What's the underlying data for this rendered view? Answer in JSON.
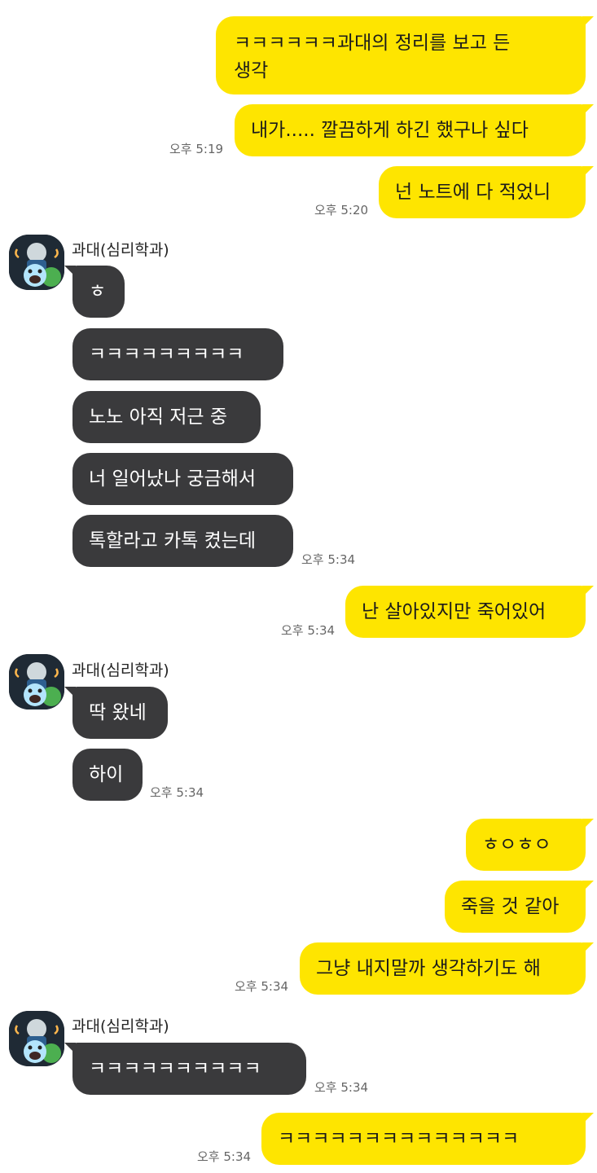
{
  "partner": {
    "name": "과대(심리학과)"
  },
  "colors": {
    "my_bubble": "#fee500",
    "their_bubble": "#3a3a3c",
    "background": "#ffffff"
  },
  "messages": [
    {
      "from": "me",
      "text": "ㅋㅋㅋㅋㅋㅋ과대의 정리를 보고 든\n생각"
    },
    {
      "from": "me",
      "text": "내가..... 깔끔하게 하긴 했구나 싶다",
      "time": "오후 5:19"
    },
    {
      "from": "me",
      "text": "넌 노트에 다 적었니",
      "time": "오후 5:20"
    },
    {
      "from": "them",
      "text": "ㅎ"
    },
    {
      "from": "them",
      "text": "ㅋㅋㅋㅋㅋㅋㅋㅋㅋ"
    },
    {
      "from": "them",
      "text": "노노 아직 저근 중"
    },
    {
      "from": "them",
      "text": "너 일어났나 궁금해서"
    },
    {
      "from": "them",
      "text": "톡할라고 카톡 켰는데",
      "time": "오후 5:34"
    },
    {
      "from": "me",
      "text": "난 살아있지만 죽어있어",
      "time": "오후 5:34"
    },
    {
      "from": "them",
      "text": "딱 왔네"
    },
    {
      "from": "them",
      "text": "하이",
      "time": "오후 5:34"
    },
    {
      "from": "me",
      "text": "ㅎㅇㅎㅇ"
    },
    {
      "from": "me",
      "text": "죽을 것 같아"
    },
    {
      "from": "me",
      "text": "그냥 내지말까 생각하기도 해",
      "time": "오후 5:34"
    },
    {
      "from": "them",
      "text": "ㅋㅋㅋㅋㅋㅋㅋㅋㅋㅋ",
      "time": "오후 5:34"
    },
    {
      "from": "me",
      "text": "ㅋㅋㅋㅋㅋㅋㅋㅋㅋㅋㅋㅋㅋㅋ",
      "time": "오후 5:34"
    }
  ]
}
